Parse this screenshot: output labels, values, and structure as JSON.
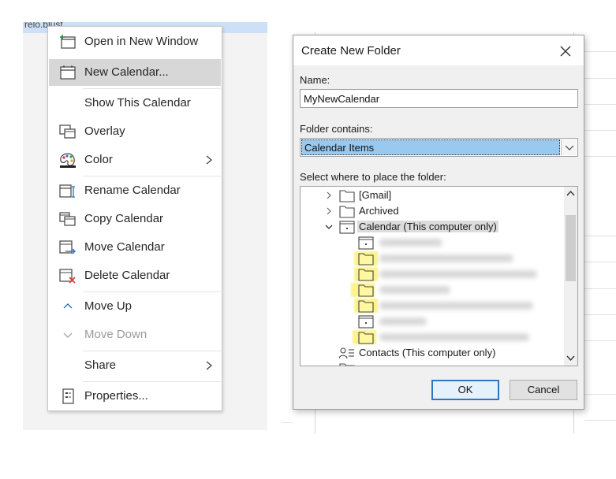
{
  "background": {
    "left_strip_text": "relo.blust"
  },
  "context_menu": {
    "items": [
      {
        "label": "Open in New Window",
        "icon": "open-window-icon"
      },
      {
        "label": "New Calendar...",
        "icon": "new-calendar-icon",
        "highlighted": true
      },
      {
        "label": "Show This Calendar",
        "icon": ""
      },
      {
        "label": "Overlay",
        "icon": "overlay-icon"
      },
      {
        "label": "Color",
        "icon": "palette-icon",
        "submenu": true
      },
      {
        "label": "Rename Calendar",
        "icon": "rename-icon"
      },
      {
        "label": "Copy Calendar",
        "icon": "copy-icon"
      },
      {
        "label": "Move Calendar",
        "icon": "move-icon"
      },
      {
        "label": "Delete Calendar",
        "icon": "delete-icon"
      },
      {
        "label": "Move Up",
        "icon": "chevron-up-icon"
      },
      {
        "label": "Move Down",
        "icon": "chevron-down-icon",
        "disabled": true
      },
      {
        "label": "Share",
        "icon": "",
        "submenu": true
      },
      {
        "label": "Properties...",
        "icon": "properties-icon"
      }
    ]
  },
  "dialog": {
    "title": "Create New Folder",
    "name_label": "Name:",
    "name_value": "MyNewCalendar",
    "contains_label": "Folder contains:",
    "contains_value": "Calendar Items",
    "place_label": "Select where to place the folder:",
    "tree": [
      {
        "label": "[Gmail]",
        "expand": "collapsed"
      },
      {
        "label": "Archived",
        "expand": "collapsed"
      },
      {
        "label": "Calendar (This computer only)",
        "expand": "expanded",
        "selected": true
      },
      {
        "label": "Contacts (This computer only)"
      }
    ],
    "ok_label": "OK",
    "cancel_label": "Cancel"
  },
  "colors": {
    "highlight": "#d7d7d7",
    "select_blue": "#99c9ef",
    "ok_border": "#2f74c7",
    "redaction_yellow": "#fbf38f"
  }
}
